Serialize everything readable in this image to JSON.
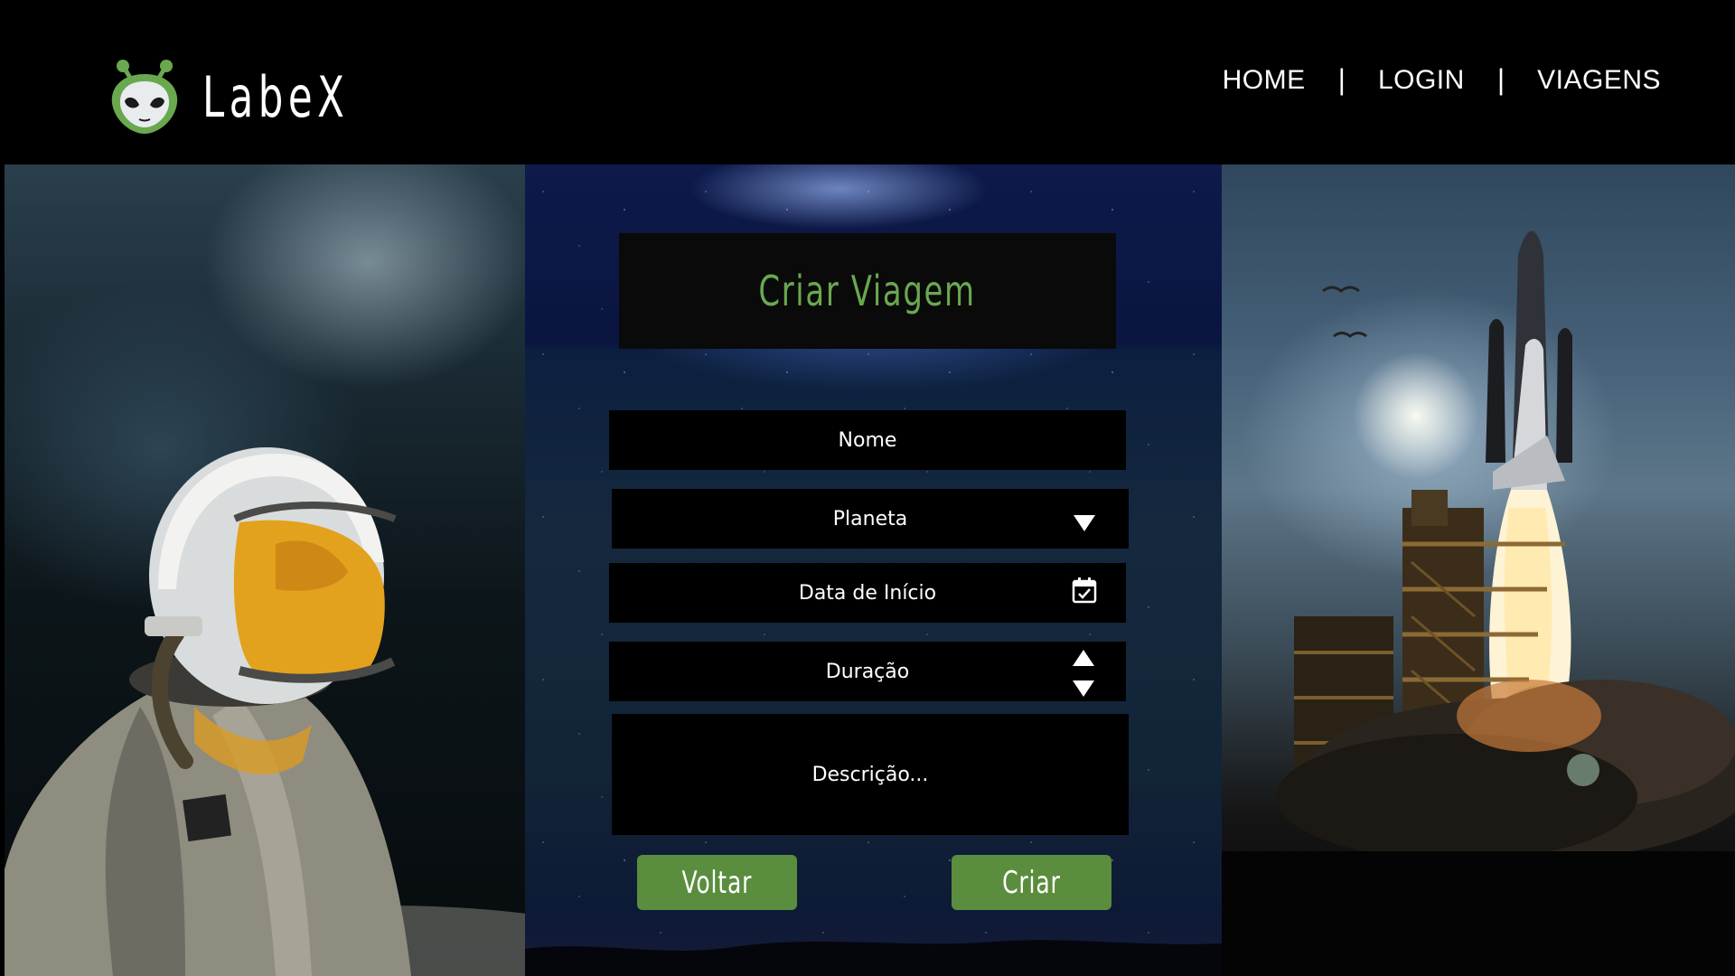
{
  "brand": {
    "name": "LabeX",
    "accent_color": "#6aa84f",
    "logo_icon": "alien-head-icon"
  },
  "nav": {
    "items": [
      {
        "label": "HOME"
      },
      {
        "label": "LOGIN"
      },
      {
        "label": "VIAGENS"
      }
    ],
    "separator": "|"
  },
  "form": {
    "title": "Criar Viagem",
    "fields": {
      "nome": {
        "placeholder": "Nome",
        "value": ""
      },
      "planeta": {
        "placeholder": "Planeta",
        "value": "",
        "icon": "caret-down-icon"
      },
      "data_inicio": {
        "placeholder": "Data de Início",
        "value": "",
        "icon": "calendar-icon"
      },
      "duracao": {
        "placeholder": "Duração",
        "value": "",
        "icons": [
          "stepper-up-icon",
          "stepper-down-icon"
        ]
      },
      "descricao": {
        "placeholder": "Descrição...",
        "value": ""
      }
    },
    "buttons": {
      "back_label": "Voltar",
      "create_label": "Criar",
      "color": "#5a8d3d"
    }
  },
  "images": {
    "left": "astronaut-photo",
    "center": "starry-sky-background",
    "right": "rocket-launch-photo"
  }
}
